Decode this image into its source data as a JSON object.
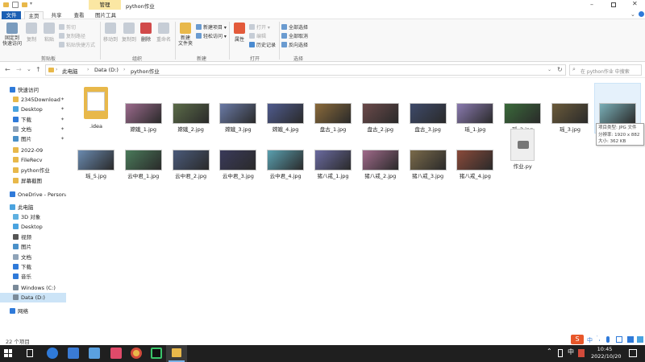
{
  "window": {
    "context_tab": "管理",
    "title": "python作业",
    "quick_access_icons": [
      "save-icon",
      "checkbox-icon",
      "folder-icon",
      "dropdown-icon"
    ],
    "controls": [
      "minimize-icon",
      "maximize-icon",
      "close-icon"
    ]
  },
  "tabs": {
    "file": "文件",
    "home": "主页",
    "share": "共享",
    "view": "查看",
    "picture_tools": "图片工具"
  },
  "ribbon": {
    "clipboard": {
      "pin": "固定到\n快速访问",
      "copy": "复制",
      "paste": "粘贴",
      "cut": "剪切",
      "copy_path": "复制路径",
      "paste_shortcut": "粘贴快捷方式",
      "label": "剪贴板"
    },
    "organize": {
      "move_to": "移动到",
      "copy_to": "复制到",
      "delete": "删除",
      "rename": "重命名",
      "label": "组织"
    },
    "new": {
      "new_folder": "新建\n文件夹",
      "new_item": "新建项目 ▾",
      "easy_access": "轻松访问 ▾",
      "label": "新建"
    },
    "open": {
      "properties": "属性",
      "open": "打开 ▾",
      "edit": "编辑",
      "history": "历史记录",
      "label": "打开"
    },
    "select": {
      "select_all": "全部选择",
      "select_none": "全部取消",
      "invert": "反向选择",
      "label": "选择"
    }
  },
  "address": {
    "path": [
      "此电脑",
      "Data (D:)",
      "python作业"
    ],
    "search_placeholder": "在 python作业 中搜索"
  },
  "nav": {
    "items": [
      {
        "label": "快速访问",
        "icon": "star-icon",
        "color": "#2f7ad9",
        "indent": 0,
        "pinned": false,
        "selected": false
      },
      {
        "label": "2345Download",
        "icon": "folder-icon",
        "color": "#e8b84a",
        "indent": 1,
        "pinned": true,
        "selected": false
      },
      {
        "label": "Desktop",
        "icon": "desktop-icon",
        "color": "#4aa3df",
        "indent": 1,
        "pinned": true,
        "selected": false
      },
      {
        "label": "下载",
        "icon": "download-icon",
        "color": "#2f7ad9",
        "indent": 1,
        "pinned": true,
        "selected": false
      },
      {
        "label": "文档",
        "icon": "document-icon",
        "color": "#8fa3b8",
        "indent": 1,
        "pinned": true,
        "selected": false
      },
      {
        "label": "图片",
        "icon": "picture-icon",
        "color": "#4a90c8",
        "indent": 1,
        "pinned": true,
        "selected": false
      },
      {
        "label": "2022-09",
        "icon": "folder-icon",
        "color": "#e8b84a",
        "indent": 1,
        "pinned": false,
        "selected": false
      },
      {
        "label": "FileRecv",
        "icon": "folder-icon",
        "color": "#e8b84a",
        "indent": 1,
        "pinned": false,
        "selected": false
      },
      {
        "label": "python作业",
        "icon": "folder-icon",
        "color": "#e8b84a",
        "indent": 1,
        "pinned": false,
        "selected": false
      },
      {
        "label": "屏幕截图",
        "icon": "folder-icon",
        "color": "#e8b84a",
        "indent": 1,
        "pinned": false,
        "selected": false
      },
      {
        "label": "OneDrive - Persona",
        "icon": "cloud-icon",
        "color": "#2f7ad9",
        "indent": 0,
        "pinned": false,
        "selected": false
      },
      {
        "label": "此电脑",
        "icon": "computer-icon",
        "color": "#4aa3df",
        "indent": 0,
        "pinned": false,
        "selected": false
      },
      {
        "label": "3D 对象",
        "icon": "cube-icon",
        "color": "#5fb0e0",
        "indent": 1,
        "pinned": false,
        "selected": false
      },
      {
        "label": "Desktop",
        "icon": "desktop-icon",
        "color": "#4aa3df",
        "indent": 1,
        "pinned": false,
        "selected": false
      },
      {
        "label": "视频",
        "icon": "video-icon",
        "color": "#555555",
        "indent": 1,
        "pinned": false,
        "selected": false
      },
      {
        "label": "图片",
        "icon": "picture-icon",
        "color": "#4a90c8",
        "indent": 1,
        "pinned": false,
        "selected": false
      },
      {
        "label": "文档",
        "icon": "document-icon",
        "color": "#8fa3b8",
        "indent": 1,
        "pinned": false,
        "selected": false
      },
      {
        "label": "下载",
        "icon": "download-icon",
        "color": "#2f7ad9",
        "indent": 1,
        "pinned": false,
        "selected": false
      },
      {
        "label": "音乐",
        "icon": "music-icon",
        "color": "#2f7ad9",
        "indent": 1,
        "pinned": false,
        "selected": false
      },
      {
        "label": "Windows (C:)",
        "icon": "drive-icon",
        "color": "#7a8a99",
        "indent": 1,
        "pinned": false,
        "selected": false
      },
      {
        "label": "Data (D:)",
        "icon": "drive-icon",
        "color": "#7a8a99",
        "indent": 1,
        "pinned": false,
        "selected": true
      },
      {
        "label": "网络",
        "icon": "network-icon",
        "color": "#2f7ad9",
        "indent": 0,
        "pinned": false,
        "selected": false
      }
    ]
  },
  "files": [
    {
      "name": ".idea",
      "kind": "folder",
      "color": "#e8b84a"
    },
    {
      "name": "嫦娥_1.jpg",
      "kind": "image",
      "color": "#9b6a8c"
    },
    {
      "name": "嫦娥_2.jpg",
      "kind": "image",
      "color": "#5b6b48"
    },
    {
      "name": "嫦娥_3.jpg",
      "kind": "image",
      "color": "#6a7aa6"
    },
    {
      "name": "嫦娥_4.jpg",
      "kind": "image",
      "color": "#4f5b8e"
    },
    {
      "name": "盘古_1.jpg",
      "kind": "image",
      "color": "#8a6a3a"
    },
    {
      "name": "盘古_2.jpg",
      "kind": "image",
      "color": "#6b4a4a"
    },
    {
      "name": "盘古_3.jpg",
      "kind": "image",
      "color": "#3e4a6a"
    },
    {
      "name": "瑶_1.jpg",
      "kind": "image",
      "color": "#8a7ab0"
    },
    {
      "name": "瑶_2.jpg",
      "kind": "image",
      "color": "#3a6a3a"
    },
    {
      "name": "瑶_3.jpg",
      "kind": "image",
      "color": "#6a5a3a"
    },
    {
      "name": "瑶_4.jpg",
      "kind": "image",
      "color": "#7ab0b8"
    },
    {
      "name": "瑶_5.jpg",
      "kind": "image",
      "color": "#6a8ab0"
    },
    {
      "name": "云中君_1.jpg",
      "kind": "image",
      "color": "#4a7a5a"
    },
    {
      "name": "云中君_2.jpg",
      "kind": "image",
      "color": "#4a5a7a"
    },
    {
      "name": "云中君_3.jpg",
      "kind": "image",
      "color": "#3a3a5a"
    },
    {
      "name": "云中君_4.jpg",
      "kind": "image",
      "color": "#5aa0b0"
    },
    {
      "name": "猪八戒_1.jpg",
      "kind": "image",
      "color": "#6a6aa0"
    },
    {
      "name": "猪八戒_2.jpg",
      "kind": "image",
      "color": "#a06a8a"
    },
    {
      "name": "猪八戒_3.jpg",
      "kind": "image",
      "color": "#7a6a4a"
    },
    {
      "name": "猪八戒_4.jpg",
      "kind": "image",
      "color": "#8a4a3a"
    },
    {
      "name": "作业.py",
      "kind": "python",
      "color": "#eeeeee"
    }
  ],
  "tooltip": {
    "type": "项目类型: JPG 文件",
    "resolution": "分辨率: 1920 x 882",
    "size": "大小: 362 KB"
  },
  "status": {
    "count": "22 个项目"
  },
  "tray": {
    "ime": "中",
    "time": "10:45",
    "date": "2022/10/20"
  },
  "taskbar_apps": [
    {
      "icon": "start-icon",
      "color": "#ffffff"
    },
    {
      "icon": "search-icon",
      "color": "#ffffff"
    },
    {
      "icon": "task-view-icon",
      "color": "#ffffff"
    },
    {
      "icon": "collab-app-icon",
      "color": "#2f7ad9"
    },
    {
      "icon": "feishu-icon",
      "color": "#3a7bd5"
    },
    {
      "icon": "email-app-icon",
      "color": "#5aa0e0"
    },
    {
      "icon": "music-app-icon",
      "color": "#e04a6a"
    },
    {
      "icon": "chrome-icon",
      "color": "#e8b84a"
    },
    {
      "icon": "pycharm-icon",
      "color": "#3ac46a"
    },
    {
      "icon": "explorer-icon",
      "color": "#e8b84a"
    }
  ]
}
